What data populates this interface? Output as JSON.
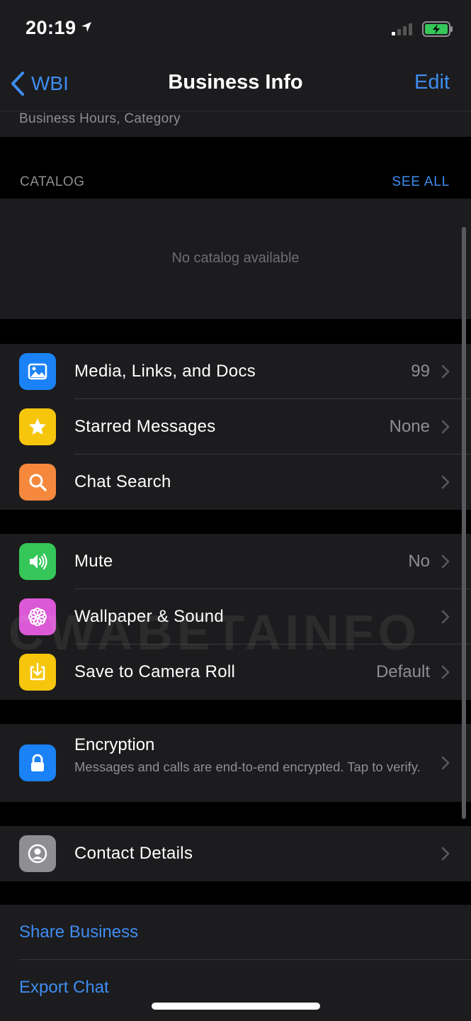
{
  "status": {
    "time": "20:19"
  },
  "nav": {
    "back_label": "WBI",
    "title": "Business Info",
    "edit_label": "Edit"
  },
  "info": {
    "subtitle": "Business Hours, Category"
  },
  "catalog": {
    "title": "CATALOG",
    "see_all": "SEE ALL",
    "empty_text": "No catalog available"
  },
  "media_group": [
    {
      "label": "Media, Links, and Docs",
      "value": "99",
      "icon": "photo-icon",
      "color": "#1a82f6"
    },
    {
      "label": "Starred Messages",
      "value": "None",
      "icon": "star-icon",
      "color": "#f6c60d"
    },
    {
      "label": "Chat Search",
      "value": "",
      "icon": "search-icon",
      "color": "#f5883c"
    }
  ],
  "settings_group": [
    {
      "label": "Mute",
      "value": "No",
      "icon": "speaker-icon",
      "color": "#35c759"
    },
    {
      "label": "Wallpaper & Sound",
      "value": "",
      "icon": "flower-icon",
      "color": "#db59d6"
    },
    {
      "label": "Save to Camera Roll",
      "value": "Default",
      "icon": "download-icon",
      "color": "#f6c60d"
    }
  ],
  "encryption": {
    "label": "Encryption",
    "subtitle": "Messages and calls are end-to-end encrypted. Tap to verify.",
    "color": "#1a82f6"
  },
  "contact": {
    "label": "Contact Details",
    "color": "#8e8e93"
  },
  "links": {
    "share": "Share Business",
    "export": "Export Chat"
  },
  "watermark": "CWABETAINFO",
  "colors": {
    "accent": "#3f8cf0",
    "background": "#000000",
    "cell": "#1c1c1e"
  }
}
